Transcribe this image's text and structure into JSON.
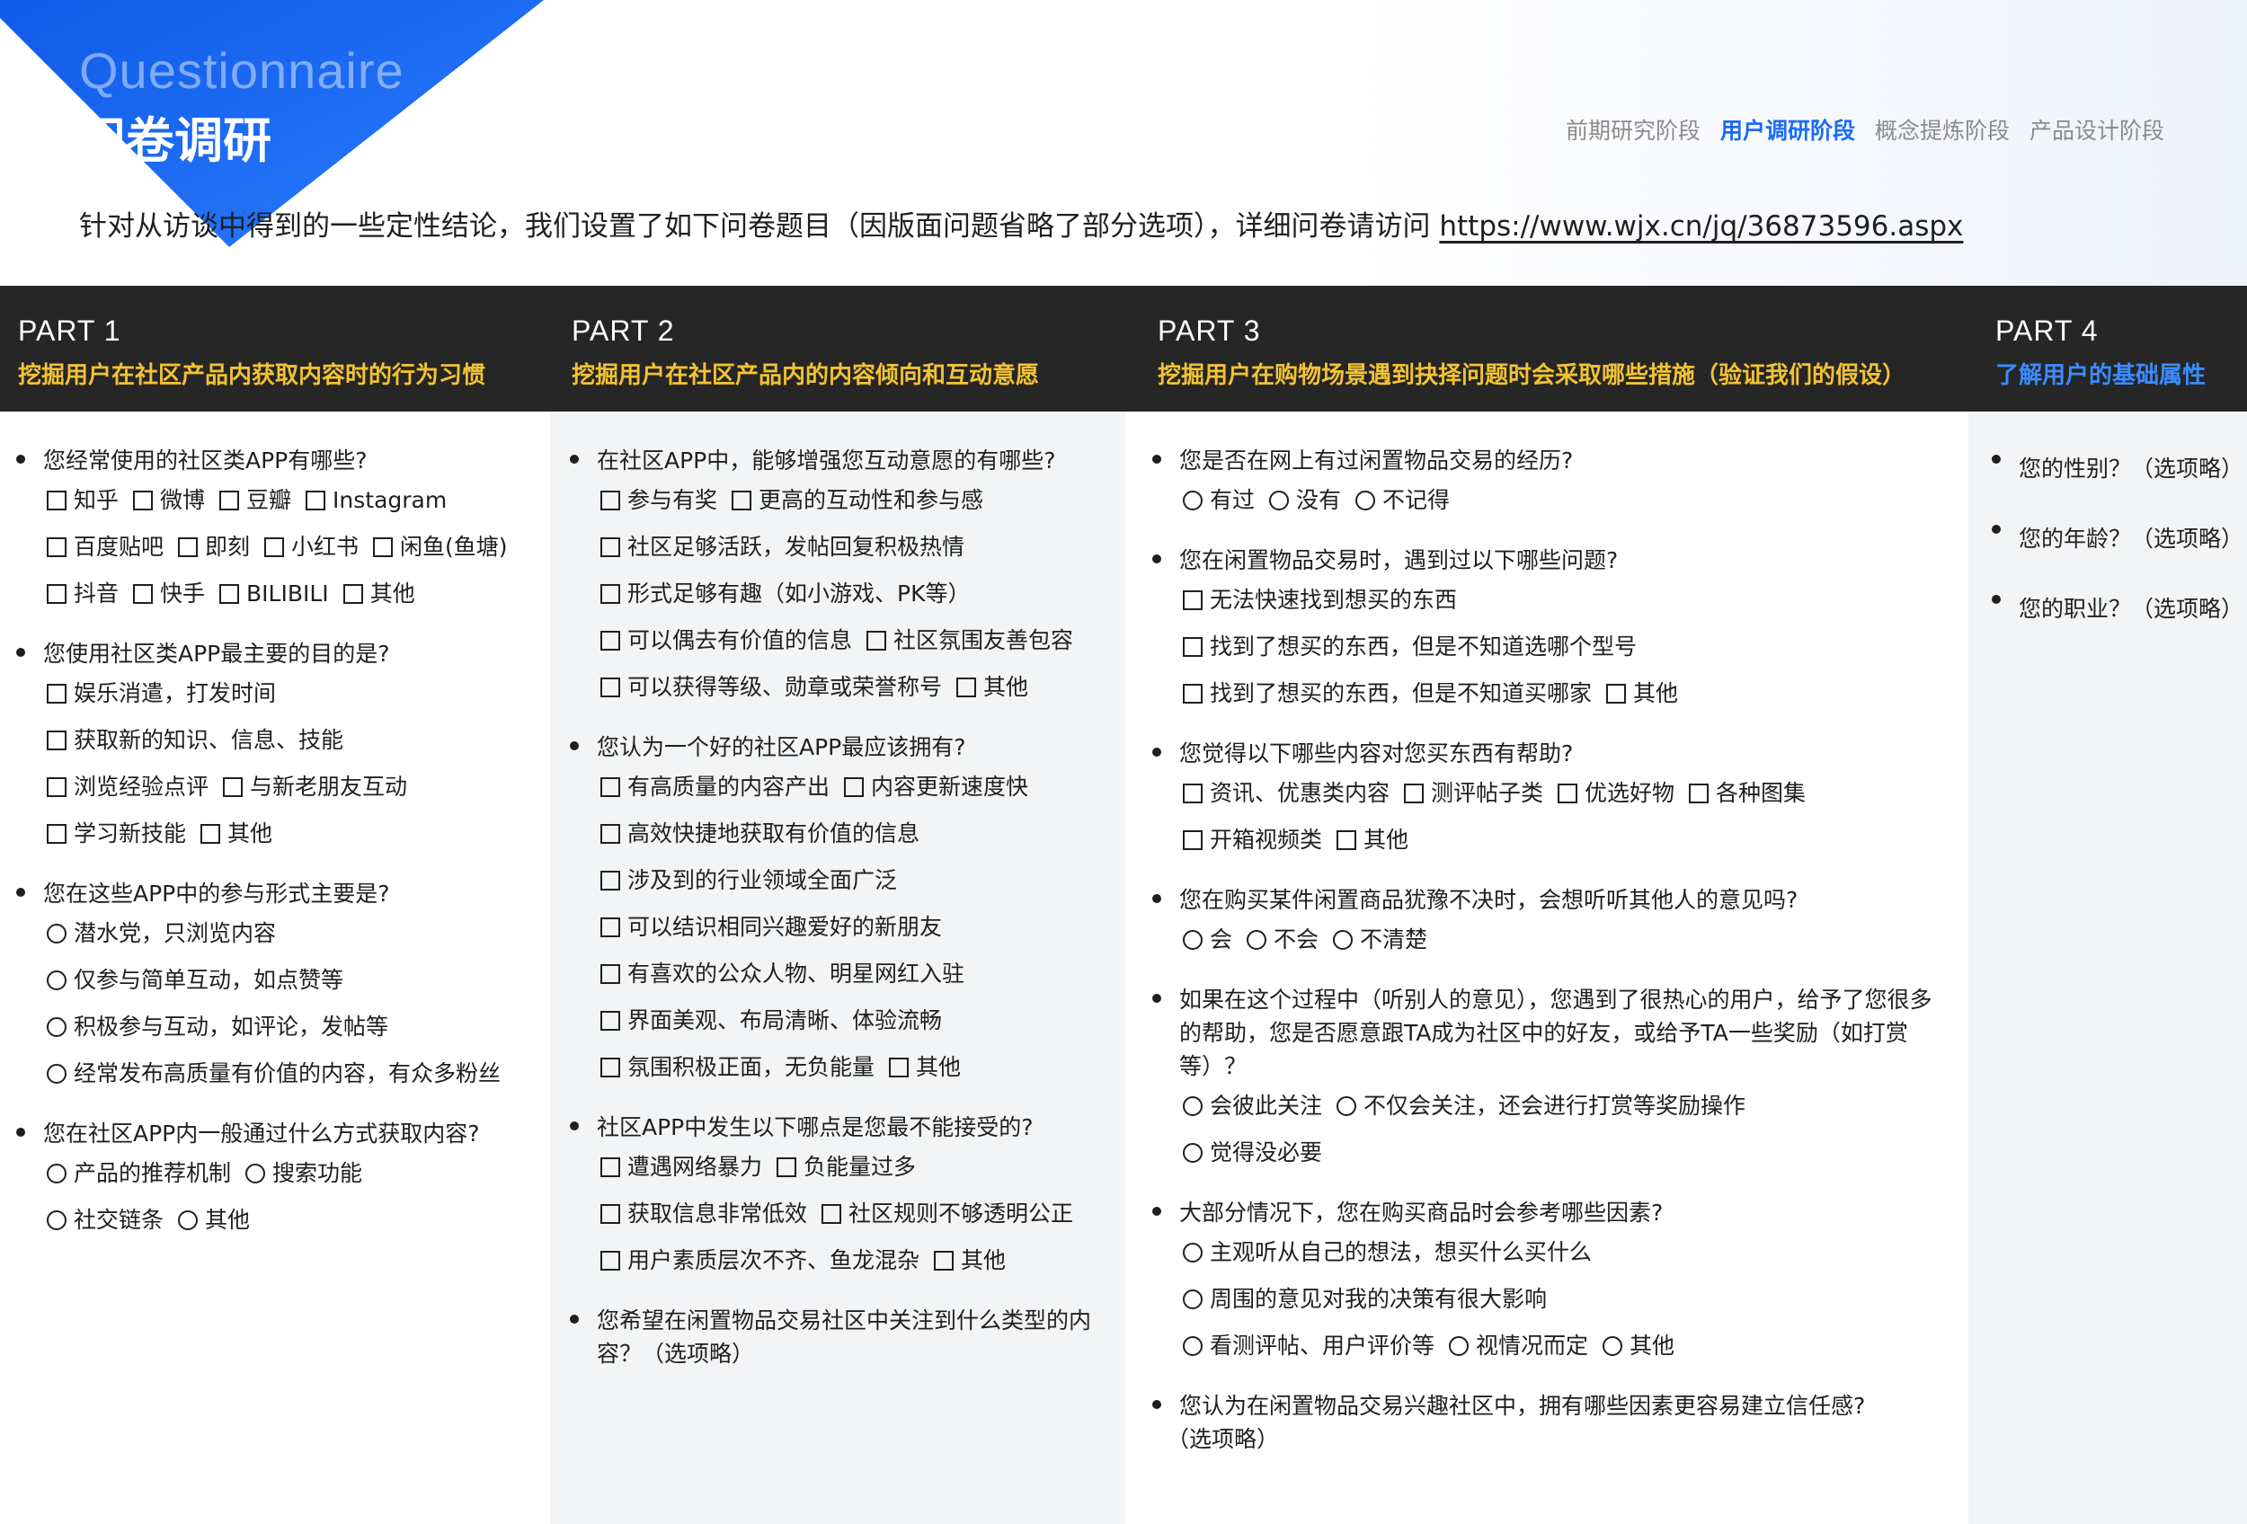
{
  "header": {
    "title_en": "Questionnaire",
    "title_cn": "问卷调研",
    "stages": [
      {
        "label": "前期研究阶段",
        "active": false
      },
      {
        "label": "用户调研阶段",
        "active": true
      },
      {
        "label": "概念提炼阶段",
        "active": false
      },
      {
        "label": "产品设计阶段",
        "active": false
      }
    ],
    "intro": "针对从访谈中得到的一些定性结论，我们设置了如下问卷题目（因版面问题省略了部分选项），详细问卷请访问 ",
    "intro_url": "https://www.wjx.cn/jq/36873596.aspx"
  },
  "colors": {
    "accent": "#1a6cf5",
    "header_bg": "#262626",
    "yellow": "#f2c233",
    "blue": "#3a8cff"
  },
  "parts": [
    {
      "num": "PART 1",
      "desc": "挖掘用户在社区产品内获取内容时的行为习惯",
      "questions": [
        {
          "text": "您经常使用的社区类APP有哪些?",
          "type": "checkbox",
          "rows": [
            [
              "知乎",
              "微博",
              "豆瓣",
              "Instagram"
            ],
            [
              "百度贴吧",
              "即刻",
              "小红书",
              "闲鱼(鱼塘)"
            ],
            [
              "抖音",
              "快手",
              "BILIBILI",
              "其他"
            ]
          ]
        },
        {
          "text": "您使用社区类APP最主要的目的是?",
          "type": "checkbox",
          "rows": [
            [
              "娱乐消遣，打发时间"
            ],
            [
              "获取新的知识、信息、技能"
            ],
            [
              "浏览经验点评",
              "与新老朋友互动"
            ],
            [
              "学习新技能",
              "其他"
            ]
          ]
        },
        {
          "text": "您在这些APP中的参与形式主要是?",
          "type": "radio",
          "rows": [
            [
              "潜水党，只浏览内容"
            ],
            [
              "仅参与简单互动，如点赞等"
            ],
            [
              "积极参与互动，如评论，发帖等"
            ],
            [
              "经常发布高质量有价值的内容，有众多粉丝"
            ]
          ]
        },
        {
          "text": "您在社区APP内一般通过什么方式获取内容?",
          "type": "radio",
          "rows": [
            [
              "产品的推荐机制",
              "搜索功能"
            ],
            [
              "社交链条",
              "其他"
            ]
          ]
        }
      ]
    },
    {
      "num": "PART 2",
      "desc": "挖掘用户在社区产品内的内容倾向和互动意愿",
      "questions": [
        {
          "text": "在社区APP中，能够增强您互动意愿的有哪些?",
          "type": "checkbox",
          "rows": [
            [
              "参与有奖",
              "更高的互动性和参与感"
            ],
            [
              "社区足够活跃，发帖回复积极热情"
            ],
            [
              "形式足够有趣（如小游戏、PK等）"
            ],
            [
              "可以偶去有价值的信息",
              "社区氛围友善包容"
            ],
            [
              "可以获得等级、勋章或荣誉称号",
              "其他"
            ]
          ]
        },
        {
          "text": "您认为一个好的社区APP最应该拥有?",
          "type": "checkbox",
          "rows": [
            [
              "有高质量的内容产出",
              "内容更新速度快"
            ],
            [
              "高效快捷地获取有价值的信息"
            ],
            [
              "涉及到的行业领域全面广泛"
            ],
            [
              "可以结识相同兴趣爱好的新朋友"
            ],
            [
              "有喜欢的公众人物、明星网红入驻"
            ],
            [
              "界面美观、布局清晰、体验流畅"
            ],
            [
              "氛围积极正面，无负能量",
              "其他"
            ]
          ]
        },
        {
          "text": "社区APP中发生以下哪点是您最不能接受的?",
          "type": "checkbox",
          "rows": [
            [
              "遭遇网络暴力",
              "负能量过多"
            ],
            [
              "获取信息非常低效",
              "社区规则不够透明公正"
            ],
            [
              "用户素质层次不齐、鱼龙混杂",
              "其他"
            ]
          ]
        },
        {
          "text": "您希望在闲置物品交易社区中关注到什么类型的内容？（选项略）",
          "type": "none",
          "rows": []
        }
      ]
    },
    {
      "num": "PART 3",
      "desc": "挖掘用户在购物场景遇到抉择问题时会采取哪些措施（验证我们的假设）",
      "questions": [
        {
          "text": "您是否在网上有过闲置物品交易的经历?",
          "type": "radio",
          "rows": [
            [
              "有过",
              "没有",
              "不记得"
            ]
          ]
        },
        {
          "text": "您在闲置物品交易时，遇到过以下哪些问题?",
          "type": "checkbox",
          "rows": [
            [
              "无法快速找到想买的东西"
            ],
            [
              "找到了想买的东西，但是不知道选哪个型号"
            ],
            [
              "找到了想买的东西，但是不知道买哪家",
              "其他"
            ]
          ]
        },
        {
          "text": "您觉得以下哪些内容对您买东西有帮助?",
          "type": "checkbox",
          "rows": [
            [
              "资讯、优惠类内容",
              "测评帖子类",
              "优选好物",
              "各种图集"
            ],
            [
              "开箱视频类",
              "其他"
            ]
          ]
        },
        {
          "text": "您在购买某件闲置商品犹豫不决时，会想听听其他人的意见吗?",
          "type": "radio",
          "rows": [
            [
              "会",
              "不会",
              "不清楚"
            ]
          ]
        },
        {
          "text": "如果在这个过程中（听别人的意见），您遇到了很热心的用户，给予了您很多的帮助，您是否愿意跟TA成为社区中的好友，或给予TA一些奖励（如打赏等）？",
          "type": "radio",
          "rows": [
            [
              "会彼此关注",
              "不仅会关注，还会进行打赏等奖励操作"
            ],
            [
              "觉得没必要"
            ]
          ]
        },
        {
          "text": "大部分情况下，您在购买商品时会参考哪些因素?",
          "type": "radio",
          "rows": [
            [
              "主观听从自己的想法，想买什么买什么"
            ],
            [
              "周围的意见对我的决策有很大影响"
            ],
            [
              "看测评帖、用户评价等",
              "视情况而定",
              "其他"
            ]
          ]
        },
        {
          "text": "您认为在闲置物品交易兴趣社区中，拥有哪些因素更容易建立信任感?",
          "type": "none",
          "note": "（选项略）",
          "rows": []
        }
      ]
    },
    {
      "num": "PART 4",
      "desc": "了解用户的基础属性",
      "questions": [
        {
          "text": "您的性别？（选项略）",
          "type": "none",
          "rows": []
        },
        {
          "text": "您的年龄？（选项略）",
          "type": "none",
          "rows": []
        },
        {
          "text": "您的职业？（选项略）",
          "type": "none",
          "rows": []
        }
      ]
    }
  ]
}
